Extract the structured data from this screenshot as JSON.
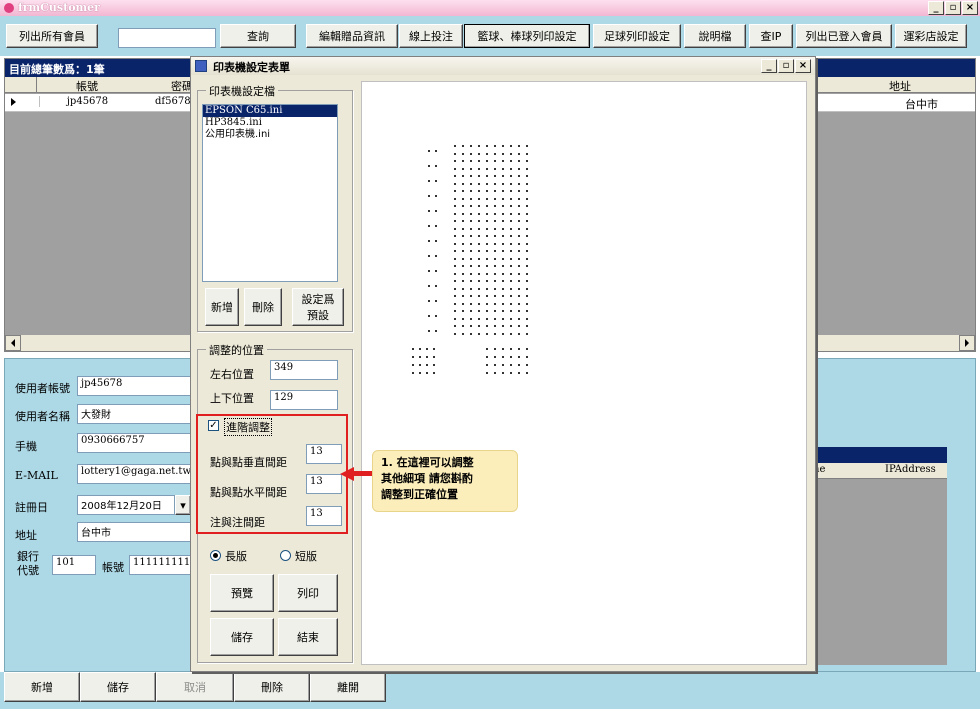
{
  "main_window": {
    "title": "frmCustomer",
    "controls": [
      "_",
      "▫",
      "×"
    ]
  },
  "toolbar": {
    "list_all": "列出所有會員",
    "search_value": "",
    "query": "查詢",
    "edit_gift": "編輯贈品資訊",
    "online_bet": "線上投注",
    "basketball_print": "籃球、棒球列印設定",
    "soccer_print": "足球列印設定",
    "help": "說明檔",
    "check_ip": "查IP",
    "list_logged": "列出已登入會員",
    "lottery_store": "運彩店設定"
  },
  "grid": {
    "total_label": "目前總筆數爲：1筆",
    "columns": [
      "帳號",
      "密碼",
      "地址"
    ],
    "rows": [
      {
        "account": "jp45678",
        "password": "df5678",
        "address": "台中市"
      }
    ]
  },
  "form": {
    "account_label": "使用者帳號",
    "account_value": "jp45678",
    "name_label": "使用者名稱",
    "name_value": "大發財",
    "phone_label": "手機",
    "phone_value": "0930666757",
    "email_label": "E-MAIL",
    "email_value": "lottery1@gaga.net.tw",
    "regdate_label": "註冊日",
    "regdate_value": "2008年12月20日",
    "address_label": "地址",
    "address_value": "台中市",
    "bank_label_1": "銀行",
    "bank_label_2": "代號",
    "bank_code": "101",
    "acct_label": "帳號",
    "acct_value": "1111111111"
  },
  "ip_panel": {
    "col1": "ne",
    "col2": "IPAddress"
  },
  "bottom_buttons": {
    "add": "新增",
    "save": "儲存",
    "cancel": "取消",
    "delete": "刪除",
    "exit": "離開"
  },
  "dialog": {
    "title": "印表機設定表單",
    "controls": [
      "_",
      "▫",
      "×"
    ],
    "printer_group": "印表機設定檔",
    "printers": [
      "EPSON C65.ini",
      "HP3845.ini",
      "公用印表機.ini"
    ],
    "selected_printer": 0,
    "btn_add": "新增",
    "btn_delete": "刪除",
    "btn_default_1": "設定爲",
    "btn_default_2": "預設",
    "position_group": "調整的位置",
    "lr_label": "左右位置",
    "lr_value": "349",
    "ud_label": "上下位置",
    "ud_value": "129",
    "advanced_label": "進階調整",
    "advanced_checked": true,
    "vspacing_label": "點與點垂直間距",
    "vspacing_value": "13",
    "hspacing_label": "點與點水平間距",
    "hspacing_value": "13",
    "note_label": "注與注間距",
    "note_value": "13",
    "long_label": "長版",
    "short_label": "短版",
    "long_selected": true,
    "btn_preview": "預覽",
    "btn_print": "列印",
    "btn_save": "儲存",
    "btn_end": "結束"
  },
  "callout": {
    "line1": "1. 在這裡可以調整",
    "line2": "其他細項  請您斟酌",
    "line3": "調整到正確位置"
  },
  "colors": {
    "accent": "#e02020",
    "panel": "#add8e6",
    "header": "#0a246a",
    "callout_bg": "#fbeebb"
  }
}
